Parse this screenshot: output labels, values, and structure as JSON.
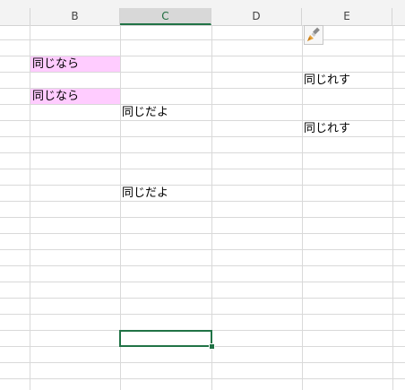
{
  "columns": [
    "B",
    "C",
    "D",
    "E"
  ],
  "selected_column": "C",
  "cells": {
    "b_row3": "同じなら",
    "e_row4": "同じれす",
    "b_row5": "同じなら",
    "c_row6": "同じだよ",
    "e_row7": "同じれす",
    "c_row11": "同じだよ"
  },
  "highlight_color": "#ffccff",
  "active_cell_color": "#217346",
  "paste_options_icon": "paintbrush-icon"
}
